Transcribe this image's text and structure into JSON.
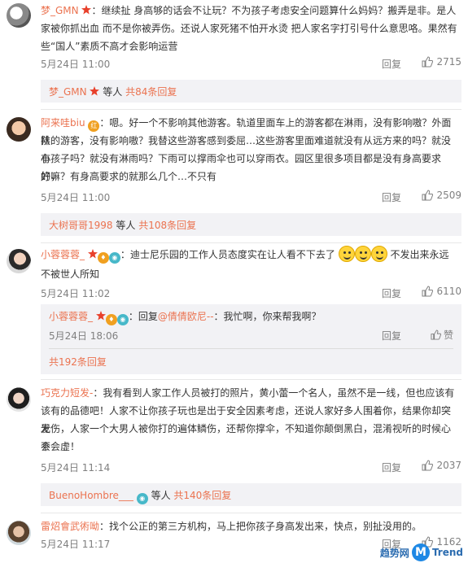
{
  "actions": {
    "reply": "回复",
    "like_icon": "thumb-up-icon",
    "zan": "赞"
  },
  "comments": [
    {
      "name": "梦_GMN",
      "badges": [
        "star"
      ],
      "sep": "：",
      "lines": [
        "继续扯 身高够的话会不让玩？不为孩子考虑安全问题算什么妈妈？搬弄是非。是人",
        "家被你抓出血 而不是你被弄伤。还说人家死猪不怕开水烫 把人家名字打引号什么意思咯。果然有",
        "些“国人”素质不高才会影响运营"
      ],
      "time": "5月24日 11:00",
      "likes": "2715",
      "more": {
        "name": "梦_GMN",
        "deng": "等人",
        "link": "共84条回复"
      }
    },
    {
      "name": "阿来哇biu",
      "badges": [
        "medal"
      ],
      "sep": "：",
      "lines": [
        "嗯。好一个不影响其他游客。轨道里面车上的游客都在淋雨，没有影响嗷？外面排",
        "队的游客，没有影响嗷？我替这些游客感到委屈…这些游客里面难道就没有从远方来的吗？就没有",
        "小孩子吗？就没有淋雨吗？下雨可以撑雨伞也可以穿雨衣。园区里很多项目都是没有身高要求的，",
        "好嘛？有身高要求的就那么几个…不只有"
      ],
      "time": "5月24日 11:00",
      "likes": "2509",
      "more": {
        "name": "大树哥哥1998",
        "deng": "等人",
        "link": "共108条回复"
      }
    },
    {
      "name": "小蓉蓉蓉_",
      "badges": [
        "star",
        "medal",
        "vip"
      ],
      "sep": "：",
      "lines": [
        "迪士尼乐园的工作人员态度实在让人看不下去了",
        "不被世人所知"
      ],
      "line1_after": "不发出来永远",
      "time": "5月24日 11:02",
      "likes": "6110",
      "sub": {
        "name": "小蓉蓉蓉_",
        "text_prefix": "：回复",
        "mention": "@倩倩欧尼--",
        "text": "：我忙啊，你来帮我啊？",
        "time": "5月24日 18:06",
        "more_link": "共192条回复"
      }
    },
    {
      "name": "巧克力短发-",
      "badges": [],
      "sep": "：",
      "lines": [
        "我有看到人家工作人员被打的照片，黄小蕾一个名人，虽然不是一线，但也应该有",
        "该有的品德吧！人家不让你孩子玩也是出于安全因素考虑，还说人家好多人围着你，结果你却突发",
        "无伤，人家一个大男人被你打的遍体鳞伤，还帮你撑伞，不知道你颠倒黑白，混淆视听的时候心会",
        "不会虚！"
      ],
      "time": "5月24日 11:14",
      "likes": "2037",
      "more": {
        "name": "BuenoHombre___",
        "deng": "等人",
        "link": "共140条回复"
      }
    },
    {
      "name": "雷炤會武術呦",
      "badges": [],
      "sep": "：",
      "lines": [
        "找个公正的第三方机构，马上把你孩子身高发出来，快点，别扯没用的。"
      ],
      "time": "5月24日 11:17",
      "likes": "1162"
    }
  ],
  "watermark": {
    "text": "趋势网",
    "logo": "M",
    "brand": "Trend"
  }
}
